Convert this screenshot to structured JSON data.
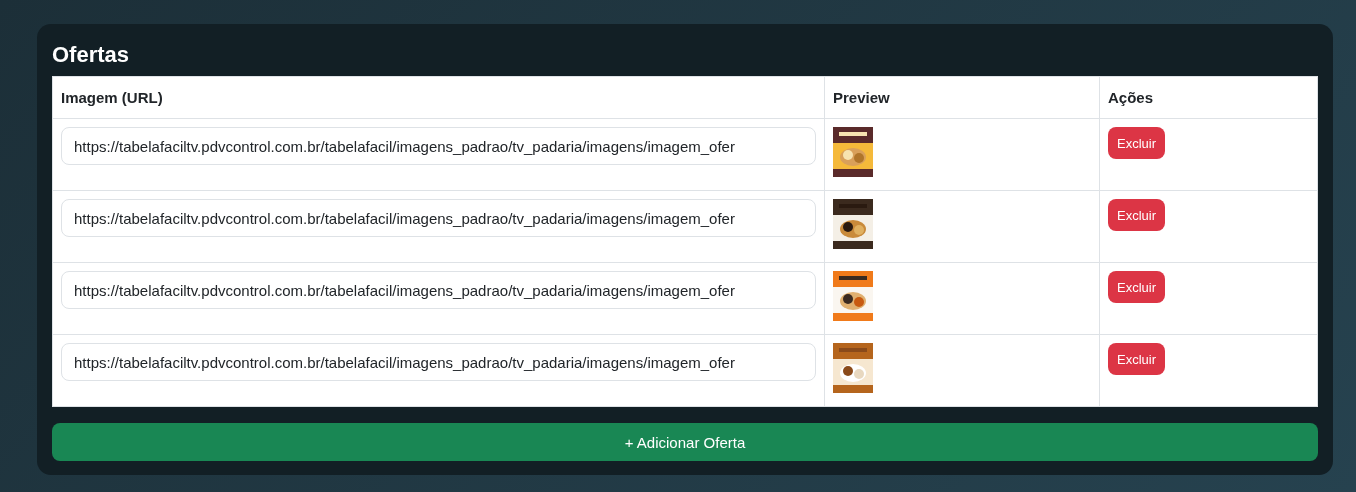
{
  "title": "Ofertas",
  "table": {
    "columns": [
      "Imagem (URL)",
      "Preview",
      "Ações"
    ],
    "rows": [
      {
        "url": "https://tabelafaciltv.pdvcontrol.com.br/tabelafacil/imagens_padrao/tv_padaria/imagens/imagem_ofer",
        "action": "Excluir"
      },
      {
        "url": "https://tabelafaciltv.pdvcontrol.com.br/tabelafacil/imagens_padrao/tv_padaria/imagens/imagem_ofer",
        "action": "Excluir"
      },
      {
        "url": "https://tabelafaciltv.pdvcontrol.com.br/tabelafacil/imagens_padrao/tv_padaria/imagens/imagem_ofer",
        "action": "Excluir"
      },
      {
        "url": "https://tabelafaciltv.pdvcontrol.com.br/tabelafacil/imagens_padrao/tv_padaria/imagens/imagem_ofer",
        "action": "Excluir"
      }
    ]
  },
  "add_button": "+ Adicionar Oferta"
}
